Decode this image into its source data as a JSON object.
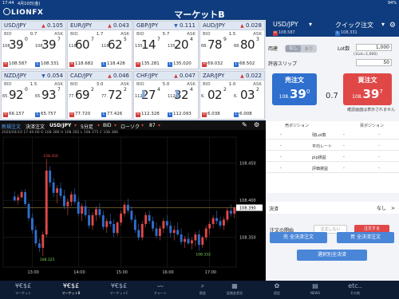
{
  "status": {
    "time": "17:44",
    "date": "4月10日(金)",
    "battery": "94%"
  },
  "header": {
    "logo": "LIONFX",
    "title": "マーケットB"
  },
  "tiles": [
    {
      "pair": "USD/JPY",
      "dir": "up",
      "change": "0.105",
      "bid_label": "BID",
      "spread": "0.7",
      "ask_label": "ASK",
      "bid_pre": "108.",
      "bid_big": "39",
      "bid_small": "0",
      "ask_pre": "108.",
      "ask_big": "39",
      "ask_small": "7",
      "low": "108.587",
      "high": "108.331",
      "low_badge": "H",
      "high_badge": "L"
    },
    {
      "pair": "EUR/JPY",
      "dir": "up",
      "change": "0.043",
      "bid_label": "BID",
      "spread": "1.7",
      "ask_label": "ASK",
      "bid_pre": "118.",
      "bid_big": "60",
      "bid_small": "7",
      "ask_pre": "118.",
      "ask_big": "62",
      "ask_small": "5",
      "low": "118.682",
      "high": "118.428",
      "low_badge": "H",
      "high_badge": "L"
    },
    {
      "pair": "GBP/JPY",
      "dir": "down",
      "change": "0.111",
      "bid_label": "BID",
      "spread": "5.7",
      "ask_label": "ASK",
      "bid_pre": "135.",
      "bid_big": "14",
      "bid_small": "7",
      "ask_pre": "135.",
      "ask_big": "20",
      "ask_small": "4",
      "low": "135.281",
      "high": "135.020",
      "low_badge": "H",
      "high_badge": "L"
    },
    {
      "pair": "AUD/JPY",
      "dir": "up",
      "change": "0.028",
      "bid_label": "BID",
      "spread": "1.5",
      "ask_label": "ASK",
      "bid_pre": "68.",
      "bid_big": "78",
      "bid_small": "9",
      "ask_pre": "68.",
      "ask_big": "80",
      "ask_small": "3",
      "low": "69.032",
      "high": "68.502",
      "low_badge": "H",
      "high_badge": "L"
    },
    {
      "pair": "NZD/JPY",
      "dir": "down",
      "change": "0.054",
      "bid_label": "BID",
      "spread": "1.5",
      "ask_label": "ASK",
      "bid_pre": "65.",
      "bid_big": "92",
      "bid_small": "0",
      "ask_pre": "65.",
      "ask_big": "93",
      "ask_small": "7",
      "low": "66.157",
      "high": "65.757",
      "low_badge": "H",
      "high_badge": "L"
    },
    {
      "pair": "CAD/JPY",
      "dir": "up",
      "change": "0.046",
      "bid_label": "BID",
      "spread": "3.0",
      "ask_label": "ASK",
      "bid_pre": "77.",
      "bid_big": "69",
      "bid_small": "2",
      "ask_pre": "77.",
      "ask_big": "72",
      "ask_small": "2",
      "low": "77.720",
      "high": "77.426",
      "low_badge": "H",
      "high_badge": "L"
    },
    {
      "pair": "CHF/JPY",
      "dir": "up",
      "change": "0.047",
      "bid_label": "BID",
      "spread": "5.0",
      "ask_label": "ASK",
      "bid_pre": "112.",
      "bid_big": "27",
      "bid_small": "4",
      "ask_pre": "112.",
      "ask_big": "32",
      "ask_small": "4",
      "low": "112.328",
      "high": "112.093",
      "low_badge": "H",
      "high_badge": "L",
      "arrow": "⬇"
    },
    {
      "pair": "ZAR/JPY",
      "dir": "up",
      "change": "0.022",
      "bid_label": "BID",
      "spread": "1.0",
      "ask_label": "ASK",
      "bid_pre": "6.",
      "bid_big": "02",
      "bid_small": "2",
      "ask_pre": "6.",
      "ask_big": "03",
      "ask_small": "2",
      "low": "6.038",
      "high": "6.008",
      "low_badge": "H",
      "high_badge": "L"
    }
  ],
  "chart_toolbar": {
    "tab_new": "新規注文",
    "tab_settle": "決済注文",
    "pair": "USD/JPY",
    "interval": "5分足",
    "side": "BID",
    "type": "ローソク",
    "count": "87"
  },
  "chart_info": "2020/04/10 17:40:00  O 108.386  H 108.392  L 108.375  C 108.386",
  "chart_data": {
    "type": "candlestick",
    "title": "USD/JPY 5分足 BID",
    "ylim": [
      108.31,
      108.485
    ],
    "y_ticks": [
      "108.450",
      "108.400",
      "108.350"
    ],
    "x_ticks": [
      "13:00",
      "14:00",
      "15:00",
      "16:00",
      "17:00"
    ],
    "current_price": "108.390",
    "annotations": [
      {
        "label": "108.456",
        "x_index": 9,
        "value": 108.456
      },
      {
        "label": "108.325",
        "x_index": 8,
        "value": 108.325
      },
      {
        "label": "108.332",
        "x_index": 52,
        "value": 108.332
      }
    ],
    "candles": [
      [
        108.405,
        108.412,
        108.398,
        108.4
      ],
      [
        108.4,
        108.408,
        108.394,
        108.404
      ],
      [
        108.404,
        108.414,
        108.402,
        108.411
      ],
      [
        108.411,
        108.415,
        108.392,
        108.395
      ],
      [
        108.395,
        108.398,
        108.372,
        108.376
      ],
      [
        108.376,
        108.382,
        108.355,
        108.36
      ],
      [
        108.36,
        108.366,
        108.338,
        108.342
      ],
      [
        108.342,
        108.348,
        108.33,
        108.336
      ],
      [
        108.336,
        108.358,
        108.325,
        108.354
      ],
      [
        108.354,
        108.456,
        108.35,
        108.44
      ],
      [
        108.44,
        108.446,
        108.418,
        108.424
      ],
      [
        108.424,
        108.43,
        108.404,
        108.41
      ],
      [
        108.41,
        108.42,
        108.396,
        108.416
      ],
      [
        108.416,
        108.424,
        108.402,
        108.406
      ],
      [
        108.406,
        108.414,
        108.388,
        108.392
      ],
      [
        108.392,
        108.402,
        108.38,
        108.398
      ],
      [
        108.398,
        108.412,
        108.392,
        108.408
      ],
      [
        108.408,
        108.416,
        108.394,
        108.398
      ],
      [
        108.398,
        108.404,
        108.378,
        108.382
      ],
      [
        108.382,
        108.396,
        108.372,
        108.392
      ],
      [
        108.392,
        108.4,
        108.376,
        108.38
      ],
      [
        108.38,
        108.388,
        108.362,
        108.366
      ],
      [
        108.366,
        108.384,
        108.36,
        108.38
      ],
      [
        108.38,
        108.392,
        108.372,
        108.388
      ],
      [
        108.388,
        108.396,
        108.376,
        108.38
      ],
      [
        108.38,
        108.386,
        108.36,
        108.364
      ],
      [
        108.364,
        108.376,
        108.356,
        108.372
      ],
      [
        108.372,
        108.382,
        108.364,
        108.368
      ],
      [
        108.368,
        108.374,
        108.35,
        108.356
      ],
      [
        108.356,
        108.372,
        108.352,
        108.37
      ],
      [
        108.37,
        108.386,
        108.366,
        108.382
      ],
      [
        108.382,
        108.398,
        108.378,
        108.394
      ],
      [
        108.394,
        108.402,
        108.382,
        108.386
      ],
      [
        108.386,
        108.392,
        108.37,
        108.374
      ],
      [
        108.374,
        108.38,
        108.356,
        108.36
      ],
      [
        108.36,
        108.368,
        108.346,
        108.35
      ],
      [
        108.35,
        108.372,
        108.346,
        108.368
      ],
      [
        108.368,
        108.384,
        108.364,
        108.38
      ],
      [
        108.38,
        108.386,
        108.368,
        108.372
      ],
      [
        108.372,
        108.378,
        108.358,
        108.362
      ],
      [
        108.362,
        108.37,
        108.348,
        108.352
      ],
      [
        108.352,
        108.366,
        108.346,
        108.362
      ],
      [
        108.362,
        108.376,
        108.356,
        108.372
      ],
      [
        108.372,
        108.38,
        108.362,
        108.366
      ],
      [
        108.366,
        108.372,
        108.35,
        108.356
      ],
      [
        108.356,
        108.366,
        108.346,
        108.36
      ],
      [
        108.36,
        108.37,
        108.352,
        108.354
      ],
      [
        108.354,
        108.362,
        108.34,
        108.344
      ],
      [
        108.344,
        108.352,
        108.336,
        108.348
      ],
      [
        108.348,
        108.356,
        108.34,
        108.342
      ],
      [
        108.342,
        108.35,
        108.334,
        108.346
      ],
      [
        108.346,
        108.358,
        108.338,
        108.354
      ],
      [
        108.354,
        108.36,
        108.332,
        108.34
      ],
      [
        108.34,
        108.352,
        108.336,
        108.35
      ],
      [
        108.35,
        108.366,
        108.346,
        108.362
      ],
      [
        108.362,
        108.372,
        108.354,
        108.368
      ],
      [
        108.368,
        108.38,
        108.362,
        108.376
      ],
      [
        108.376,
        108.386,
        108.368,
        108.372
      ],
      [
        108.372,
        108.378,
        108.362,
        108.366
      ],
      [
        108.366,
        108.378,
        108.36,
        108.374
      ],
      [
        108.374,
        108.39,
        108.37,
        108.386
      ],
      [
        108.386,
        108.394,
        108.378,
        108.382
      ],
      [
        108.382,
        108.392,
        108.376,
        108.39
      ]
    ]
  },
  "nav": [
    {
      "icon": "¥€$£",
      "label": "マーケット"
    },
    {
      "icon": "¥€$£",
      "label": "マーケットB"
    },
    {
      "icon": "¥€$£",
      "label": "マーケットC"
    },
    {
      "icon": "〰",
      "label": "チャート"
    },
    {
      "icon": "⌕",
      "label": "照会"
    },
    {
      "icon": "▦",
      "label": "証拠金状況"
    },
    {
      "icon": "✿",
      "label": "設定"
    },
    {
      "icon": "▤",
      "label": "NEWS"
    },
    {
      "icon": "etc..",
      "label": "その他"
    }
  ],
  "order": {
    "pair": "USD/JPY",
    "quick": "クイック注文",
    "bid_small": "108.587",
    "ask_small": "108.331",
    "ryodate": "両建",
    "toggle_on": "なし",
    "toggle_off": "あり",
    "lot_label": "Lot数",
    "lot_value": "1,000",
    "lot_sub": "(1Lot=1,000)",
    "slip_label": "許容スリップ",
    "slip_value": "50",
    "sell_label": "売注文",
    "buy_label": "買注文",
    "sell_pre": "108.",
    "sell_big": "39",
    "sell_small": "0",
    "buy_pre": "108.",
    "buy_big": "39",
    "buy_small": "7",
    "spread": "0.7",
    "confirm": "確認画面は表示されません",
    "pos_sell": "売ポジション",
    "pos_buy": "買ポジション",
    "pos_rows": [
      {
        "c1": "-",
        "c2": "-",
        "label": "残Lot数",
        "c3": "-",
        "c4": "-"
      },
      {
        "c1": "-",
        "c2": "-",
        "label": "平均レート",
        "c3": "-",
        "c4": "-"
      },
      {
        "c1": "-",
        "c2": "-",
        "label": "pip損益",
        "c3": "-",
        "c4": "-"
      },
      {
        "c1": "-",
        "c2": "-",
        "label": "評価損益",
        "c3": "-",
        "c4": "-"
      }
    ],
    "settle_label": "決済",
    "settle_value": "なし　>",
    "start_label": "注文の開始",
    "start_no": "注文しない",
    "start_yes": "注文する",
    "btn_sell_all": "売 全決済注文",
    "btn_buy_all": "買 全決済注文",
    "btn_select": "選択別全決済"
  },
  "colors": {
    "header": "#0f3c7e",
    "sell": "#2f6fce",
    "buy": "#e04848",
    "up_candle": "#e04848",
    "down_candle": "#2f6fce"
  }
}
